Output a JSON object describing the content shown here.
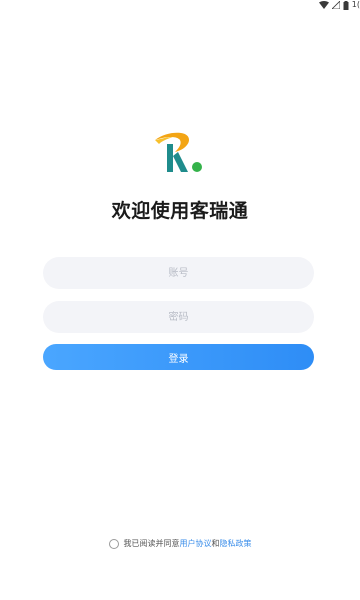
{
  "status_bar": {
    "wifi_icon": "wifi-icon",
    "signal_icon": "signal-icon",
    "battery_icon": "battery-icon",
    "time_text": "1("
  },
  "logo": {
    "icon": "app-logo",
    "colors": {
      "orange": "#f3a515",
      "teal": "#1f8c8c",
      "green": "#34b24a"
    }
  },
  "welcome_title": "欢迎使用客瑞通",
  "login_form": {
    "account_placeholder": "账号",
    "password_placeholder": "密码",
    "login_button_label": "登录"
  },
  "agreement": {
    "prefix_text": "我已阅读并同意",
    "user_agreement_link": "用户协议",
    "and_text": "和",
    "privacy_policy_link": "隐私政策",
    "checked": false
  },
  "colors": {
    "accent": "#3b8eea",
    "field_background": "#f3f4f8"
  }
}
